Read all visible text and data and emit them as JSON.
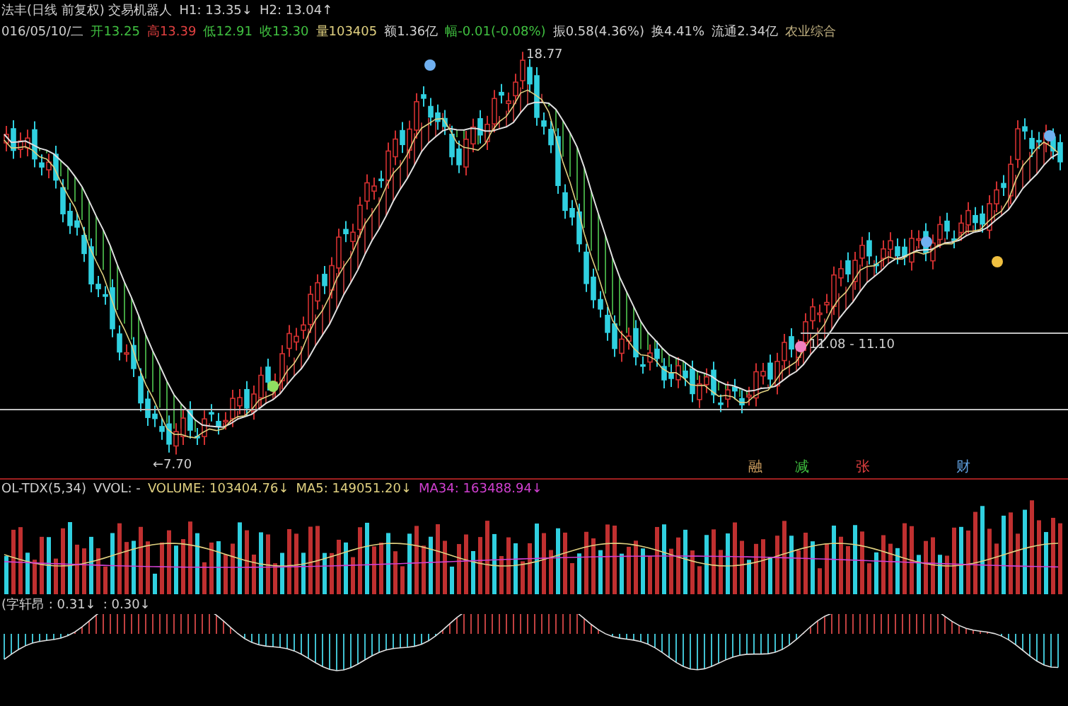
{
  "header": {
    "title_line": [
      {
        "text": "法丰(日线 前复权) 交易机器人",
        "color": "#d0d0d0"
      },
      {
        "text": "H1: 13.35↓",
        "color": "#d0d0d0"
      },
      {
        "text": "H2: 13.04↑",
        "color": "#d0d0d0"
      }
    ],
    "quote_line": [
      {
        "text": "016/05/10/二",
        "color": "#d0d0d0"
      },
      {
        "text": "开13.25",
        "color": "#40c040"
      },
      {
        "text": "高13.39",
        "color": "#e04040"
      },
      {
        "text": "低12.91",
        "color": "#40c040"
      },
      {
        "text": "收13.30",
        "color": "#40c040"
      },
      {
        "text": "量103405",
        "color": "#e0d080"
      },
      {
        "text": "额1.36亿",
        "color": "#d0d0d0"
      },
      {
        "text": "幅-0.01(-0.08%)",
        "color": "#40c040"
      },
      {
        "text": "振0.58(4.36%)",
        "color": "#d0d0d0"
      },
      {
        "text": "换4.41%",
        "color": "#d0d0d0"
      },
      {
        "text": "流通2.34亿",
        "color": "#d0d0d0"
      },
      {
        "text": "农业综合",
        "color": "#c0b080"
      }
    ]
  },
  "main_chart": {
    "labels": [
      {
        "text": "18.77"
      },
      {
        "text": "←7.70"
      },
      {
        "text": "11.08 - 11.10"
      }
    ],
    "event_markers": [
      {
        "text": "融",
        "color": "#d0a060"
      },
      {
        "text": "减",
        "color": "#40c040"
      },
      {
        "text": "张",
        "color": "#e04040"
      },
      {
        "text": "财",
        "color": "#60a0e0"
      }
    ]
  },
  "volume_panel": {
    "legend": [
      {
        "text": "OL-TDX(5,34)",
        "color": "#d0d0d0"
      },
      {
        "text": "VVOL: -",
        "color": "#d0d0d0"
      },
      {
        "text": "VOLUME: 103404.76↓",
        "color": "#e0d080"
      },
      {
        "text": "MA5: 149051.20↓",
        "color": "#e0d080"
      },
      {
        "text": "MA34: 163488.94↓",
        "color": "#d040d0"
      }
    ]
  },
  "oscillator_panel": {
    "legend": [
      {
        "text": "(字轩昂 : 0.31↓",
        "color": "#d0d0d0"
      },
      {
        "text": ": 0.30↓",
        "color": "#d0d0d0"
      }
    ]
  }
}
